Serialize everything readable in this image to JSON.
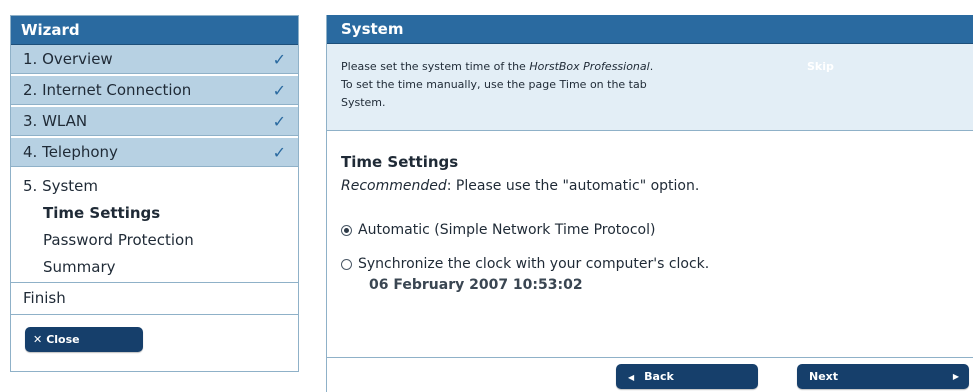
{
  "wizard": {
    "title": "Wizard",
    "steps": [
      {
        "label": "1. Overview",
        "check": "✓"
      },
      {
        "label": "2. Internet Connection",
        "check": "✓"
      },
      {
        "label": "3. WLAN",
        "check": "✓"
      },
      {
        "label": "4. Telephony",
        "check": "✓"
      }
    ],
    "current_step": {
      "label": "5. System",
      "substeps": [
        "Time Settings",
        "Password Protection",
        "Summary"
      ],
      "active_substep": "Time Settings"
    },
    "finish_label": "Finish",
    "close_label": "Close"
  },
  "panel": {
    "title": "System",
    "intro": {
      "line1_prefix": "Please set the system time of the ",
      "brand": "HorstBox Professional",
      "line1_suffix": ".",
      "line2": "To set the time manually, use the page Time on the tab",
      "line3": "System.",
      "skip_label": "Skip"
    },
    "time_settings": {
      "title": "Time Settings",
      "hint_emphasis": "Recommended",
      "hint_rest": ": Please use the \"automatic\" option.",
      "options": [
        {
          "label": "Automatic (Simple Network Time Protocol)",
          "selected": true
        },
        {
          "label": "Synchronize the clock with your computer's clock.",
          "selected": false
        }
      ],
      "datetime": "06 February 2007 10:53:02"
    },
    "footer": {
      "back_label": "Back",
      "next_label": "Next"
    }
  },
  "colors": {
    "header_blue": "#2a6aa0",
    "step_bg": "#b7d1e3",
    "intro_bg": "#e3eef6",
    "button_navy": "#163f6b",
    "border": "#8fb1c8"
  },
  "icons": {
    "step_done": "checkmark-icon",
    "close": "close-icon",
    "back": "arrow-left-icon",
    "next": "arrow-right-icon"
  }
}
